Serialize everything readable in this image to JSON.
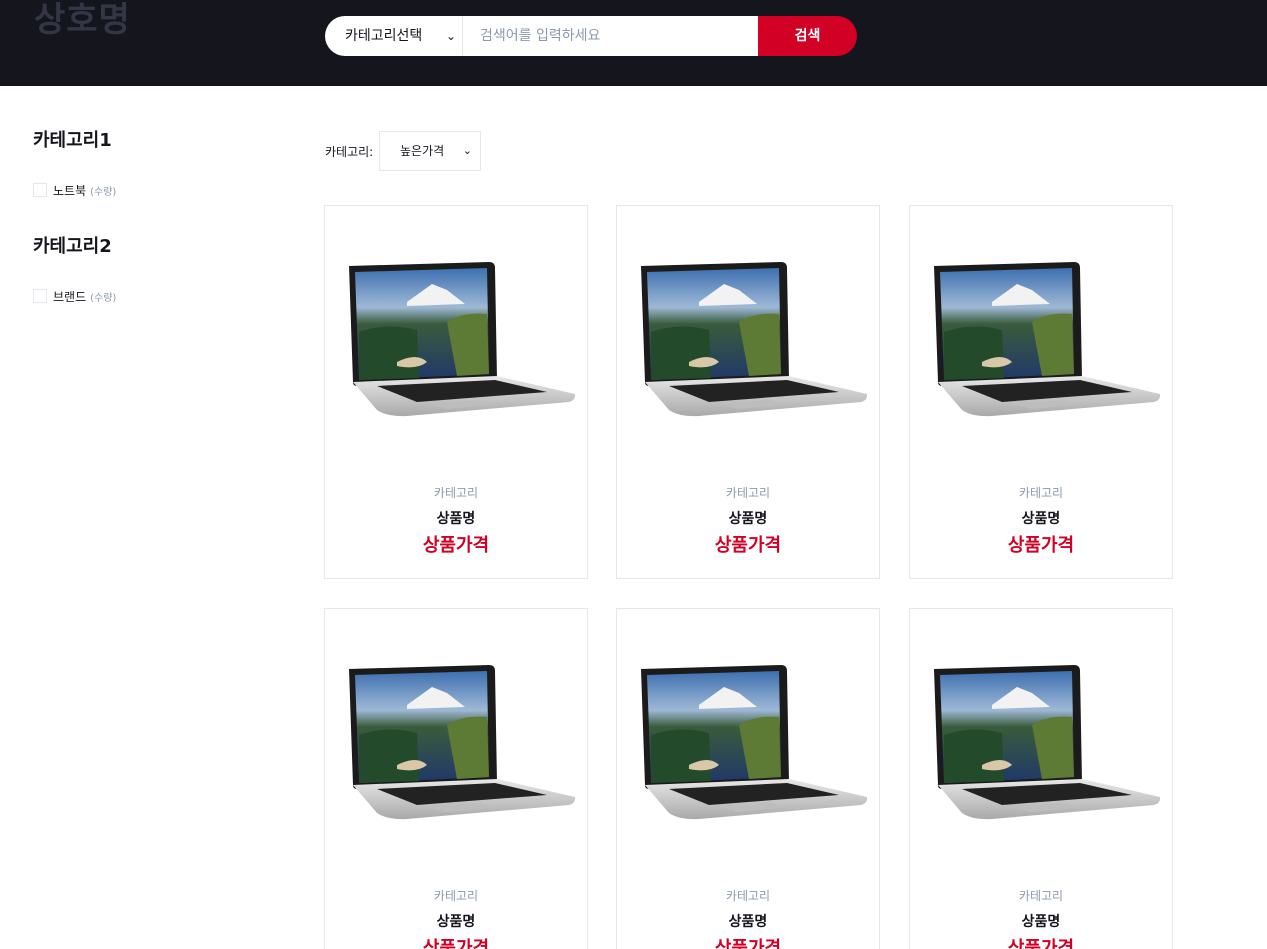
{
  "header": {
    "logo": "상호명",
    "search_category": "카테고리선택",
    "search_placeholder": "검색어를 입력하세요",
    "search_button": "검색"
  },
  "aside": {
    "groups": [
      {
        "title": "카테고리1",
        "item": "노트북",
        "qty": "(수량)"
      },
      {
        "title": "카테고리2",
        "item": "브랜드",
        "qty": "(수량)"
      }
    ]
  },
  "store": {
    "sort_label": "카테고리:",
    "sort_value": "높은가격"
  },
  "products": [
    {
      "category": "카테고리",
      "name": "상품명",
      "price": "상품가격"
    },
    {
      "category": "카테고리",
      "name": "상품명",
      "price": "상품가격"
    },
    {
      "category": "카테고리",
      "name": "상품명",
      "price": "상품가격"
    },
    {
      "category": "카테고리",
      "name": "상품명",
      "price": "상품가격"
    },
    {
      "category": "카테고리",
      "name": "상품명",
      "price": "상품가격"
    },
    {
      "category": "카테고리",
      "name": "상품명",
      "price": "상품가격"
    }
  ],
  "colors": {
    "header_bg": "#15161d",
    "accent": "#d10024",
    "muted": "#8d99ae",
    "border": "#e4e7ed"
  }
}
